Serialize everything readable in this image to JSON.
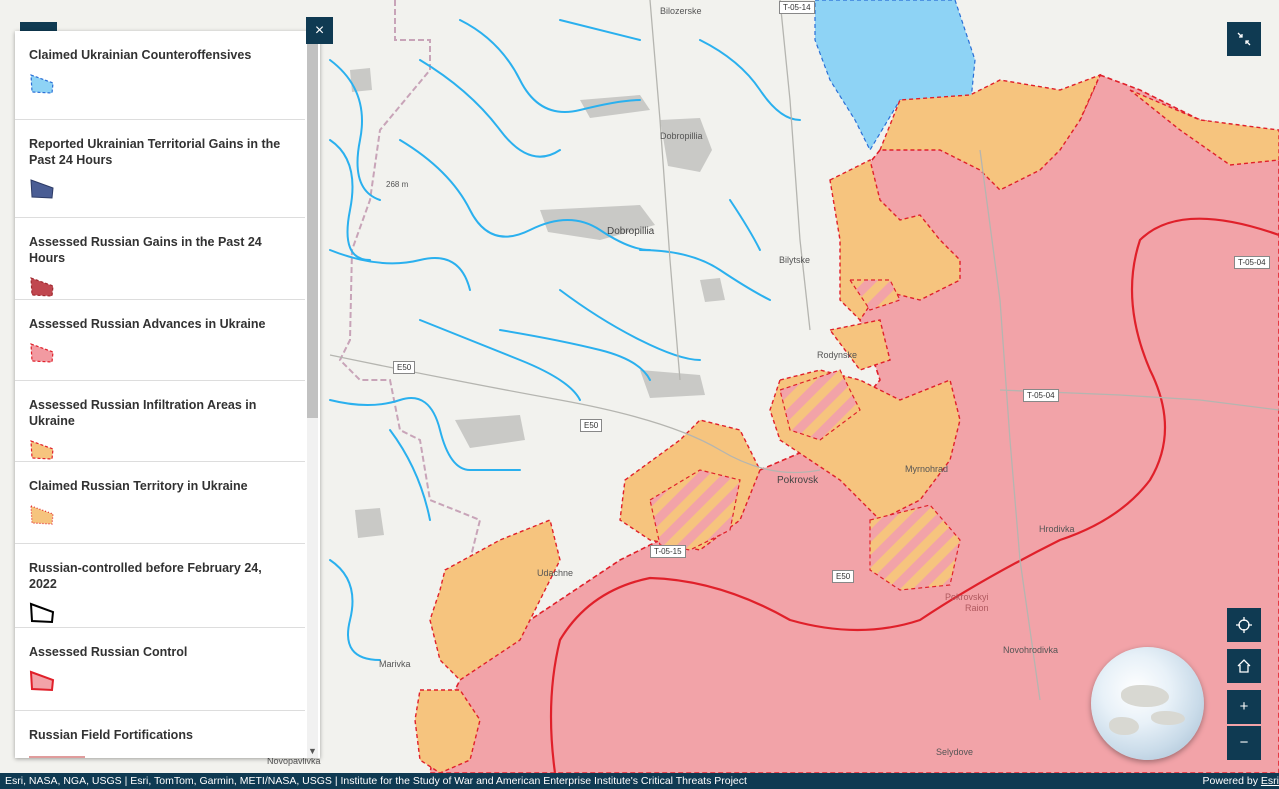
{
  "legend": {
    "items": [
      {
        "title": "Claimed Ukrainian Counteroffensives",
        "swatch_fill": "#8ed3f5",
        "swatch_stroke": "#2a6fd6",
        "swatch_style": "dashed"
      },
      {
        "title": "Reported Ukrainian Territorial Gains in the Past 24 Hours",
        "swatch_fill": "#4a5d94",
        "swatch_stroke": "#2d3b66",
        "swatch_style": "solid"
      },
      {
        "title": "Assessed Russian Gains in the Past 24 Hours",
        "swatch_fill": "#c0474f",
        "swatch_stroke": "#a02a30",
        "swatch_style": "dashed"
      },
      {
        "title": "Assessed Russian Advances in Ukraine",
        "swatch_fill": "#f29aa1",
        "swatch_stroke": "#e0202a",
        "swatch_style": "dashed"
      },
      {
        "title": "Assessed Russian Infiltration Areas in Ukraine",
        "swatch_fill": "#f6c47e",
        "swatch_stroke": "#e0202a",
        "swatch_style": "dashed"
      },
      {
        "title": "Claimed Russian Territory in Ukraine",
        "swatch_fill": "#f6c47e",
        "swatch_stroke": "#e0202a",
        "swatch_style": "dotted"
      },
      {
        "title": "Russian-controlled before February 24, 2022",
        "swatch_fill": "#ffffff",
        "swatch_stroke": "#000000",
        "swatch_style": "solid"
      },
      {
        "title": "Assessed Russian Control",
        "swatch_fill": "#f2a3a8",
        "swatch_stroke": "#e0202a",
        "swatch_style": "solid"
      },
      {
        "title": "Russian Field Fortifications",
        "swatch_fill": "none",
        "swatch_stroke": "#c03a3a",
        "swatch_style": "line"
      }
    ],
    "close_icon": "close-icon"
  },
  "map": {
    "place_labels": [
      {
        "key": "bilozerske",
        "text": "Bilozerske"
      },
      {
        "key": "dobropillia_upper",
        "text": "Dobropillia"
      },
      {
        "key": "dobropillia",
        "text": "Dobropillia"
      },
      {
        "key": "bilytske",
        "text": "Bilytske"
      },
      {
        "key": "rodynske",
        "text": "Rodynske"
      },
      {
        "key": "pokrovsk",
        "text": "Pokrovsk"
      },
      {
        "key": "myrnohrad",
        "text": "Myrnohrad"
      },
      {
        "key": "udachne",
        "text": "Udachne"
      },
      {
        "key": "hrodivka",
        "text": "Hrodivka"
      },
      {
        "key": "pokrovskyi_raion_1",
        "text": "Pokrovskyi"
      },
      {
        "key": "pokrovskyi_raion_2",
        "text": "Raion"
      },
      {
        "key": "novohrodivka",
        "text": "Novohrodivka"
      },
      {
        "key": "selydove",
        "text": "Selydove"
      },
      {
        "key": "marivka",
        "text": "Marivka"
      },
      {
        "key": "novopavlivka",
        "text": "Novopavlivka"
      },
      {
        "key": "elevation",
        "text": "268 m"
      }
    ],
    "road_shields": [
      {
        "key": "t0514",
        "text": "T-05-14"
      },
      {
        "key": "t0504a",
        "text": "T-05-04"
      },
      {
        "key": "t0504b",
        "text": "T-05-04"
      },
      {
        "key": "e50a",
        "text": "E50"
      },
      {
        "key": "e50b",
        "text": "E50"
      },
      {
        "key": "e50c",
        "text": "E50"
      },
      {
        "key": "t0515",
        "text": "T-05-15"
      }
    ],
    "colors": {
      "background": "#f2f2ee",
      "water": "#2ab0ee",
      "russian_control": "#f2a3a8",
      "infiltration": "#f6c47e",
      "counteroffensive": "#8ed3f5",
      "frontline": "#e0202a",
      "ui_dark": "#0f3a52"
    }
  },
  "controls": {
    "collapse_icon": "collapse-arrows-icon",
    "locate_icon": "locate-crosshair-icon",
    "home_icon": "home-icon",
    "zoom_in": "+",
    "zoom_out": "−"
  },
  "attribution": {
    "text": "Esri, NASA, NGA, USGS | Esri, TomTom, Garmin, METI/NASA, USGS | Institute for the Study of War and American Enterprise Institute's Critical Threats Project",
    "powered_by": "Powered by",
    "esri": "Esri"
  }
}
